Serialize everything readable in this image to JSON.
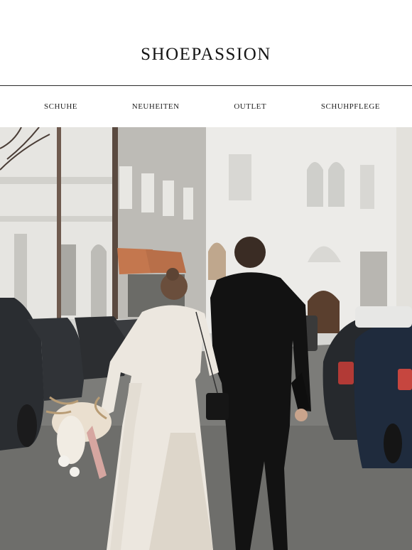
{
  "header": {
    "brand": "SHOEPASSION"
  },
  "nav": {
    "items": [
      {
        "label": "SCHUHE"
      },
      {
        "label": "NEUHEITEN"
      },
      {
        "label": "OUTLET"
      },
      {
        "label": "SCHUHPFLEGE"
      }
    ]
  },
  "hero": {
    "alt": "Brautpaar läuft Hand in Hand eine Straße entlang"
  },
  "colors": {
    "text": "#141414",
    "rule": "#2a2a2a",
    "background": "#ffffff"
  }
}
